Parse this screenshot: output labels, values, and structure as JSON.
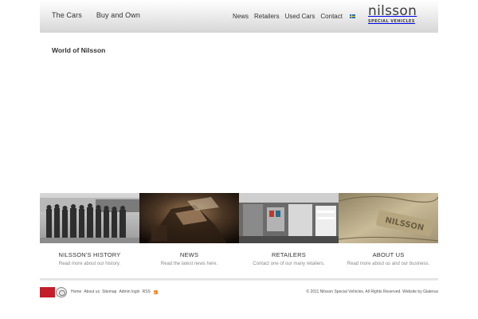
{
  "header": {
    "main_nav": [
      "The Cars",
      "Buy and Own"
    ],
    "top_nav": [
      "News",
      "Retailers",
      "Used Cars",
      "Contact"
    ],
    "language_flag": "swedish-flag-icon",
    "logo": {
      "word": "nilsson",
      "subtitle": "SPECIAL VEHICLES"
    }
  },
  "main": {
    "page_title": "World of Nilsson"
  },
  "features": [
    {
      "title": "NILSSON'S HISTORY",
      "description": "Read more about our history.",
      "image": "historic-photo"
    },
    {
      "title": "NEWS",
      "description": "Read the latest news here.",
      "image": "vehicle-interior-photo"
    },
    {
      "title": "RETAILERS",
      "description": "Contact one of our many retailers.",
      "image": "ambulance-interior-photo"
    },
    {
      "title": "ABOUT US",
      "description": "Read more about us and our business.",
      "image": "leather-seat-photo"
    }
  ],
  "footer": {
    "links": [
      "Home",
      "About us",
      "Sitemap",
      "Admin login",
      "RSS"
    ],
    "rss_icon": "rss-icon",
    "copyright": "© 2011 Nilsson Special Vehicles. All Rights Reserved. Website by Glaterus",
    "cert_badge": "certification-badge"
  }
}
